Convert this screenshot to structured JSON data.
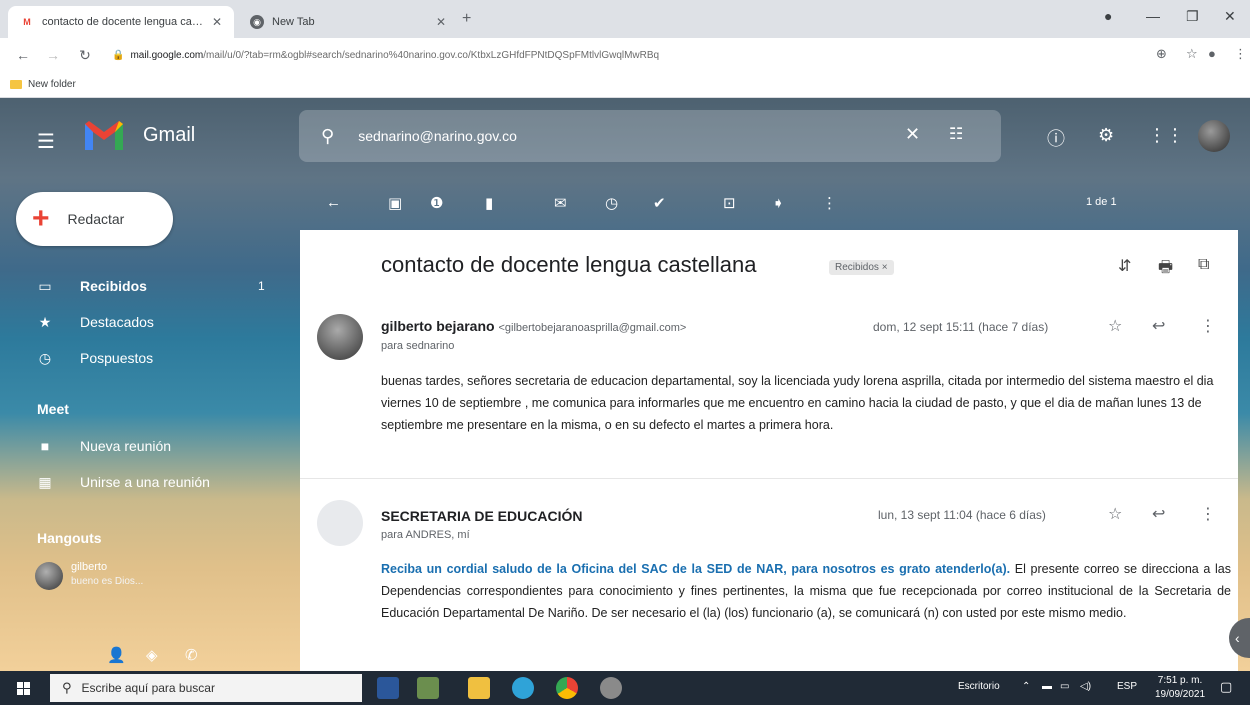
{
  "browser": {
    "tabs": [
      {
        "title": "contacto de docente lengua castel",
        "active": true
      },
      {
        "title": "New Tab",
        "active": false
      }
    ],
    "url_host": "mail.google.com",
    "url_path": "/mail/u/0/?tab=rm&ogbl#search/sednarino%40narino.gov.co/KtbxLzGHfdFPNtDQSpFMtlvlGwqlMwRBq",
    "bookmark": "New folder"
  },
  "gmail": {
    "brand": "Gmail",
    "search_query": "sednarino@narino.gov.co",
    "compose_label": "Redactar",
    "nav": [
      {
        "label": "Recibidos",
        "count": "1",
        "icon": "inbox-icon",
        "bold": true
      },
      {
        "label": "Destacados",
        "count": "",
        "icon": "star-icon",
        "bold": false
      },
      {
        "label": "Pospuestos",
        "count": "",
        "icon": "clock-icon",
        "bold": false
      }
    ],
    "meet": {
      "title": "Meet",
      "items": [
        {
          "label": "Nueva reunión",
          "icon": "video-icon"
        },
        {
          "label": "Unirse a una reunión",
          "icon": "keyboard-icon"
        }
      ]
    },
    "hangouts": {
      "title": "Hangouts",
      "user": "gilberto",
      "status": "bueno es Dios..."
    },
    "pager": "1 de 1"
  },
  "thread": {
    "subject": "contacto de docente lengua castellana",
    "label": "Recibidos ×",
    "messages": [
      {
        "from": "gilberto bejarano",
        "email": "<gilbertobejaranoasprilla@gmail.com>",
        "to": "para sednarino",
        "date": "dom, 12 sept 15:11 (hace 7 días)",
        "body": "buenas tardes, señores secretaria de educacion departamental, soy la licenciada yudy lorena asprilla, citada por intermedio del sistema maestro el dia viernes 10 de septiembre , me comunica para informarles que me encuentro  en camino hacia la ciudad de pasto, y que el dia de mañan lunes 13 de septiembre me presentare en la misma, o en su defecto el martes a primera hora."
      },
      {
        "from": "SECRETARIA DE EDUCACIÓN",
        "to": "para ANDRES, mí",
        "date": "lun, 13 sept 11:04 (hace 6 días)",
        "body_bold": "Reciba un cordial saludo de la Oficina del SAC de la SED de NAR, para nosotros es grato atenderlo(a).",
        "body": " El presente correo se direcciona a las Dependencias correspondientes para conocimiento y fines pertinentes, la misma que fue recepcionada por correo institucional de la Secretaria de Educación Departamental De Nariño. De ser necesario el (la) (los) funcionario (a), se comunicará (n) con usted por este mismo medio."
      }
    ]
  },
  "taskbar": {
    "search_placeholder": "Escribe aquí para buscar",
    "desktop_label": "Escritorio",
    "lang": "ESP",
    "time": "7:51 p. m.",
    "date": "19/09/2021"
  }
}
